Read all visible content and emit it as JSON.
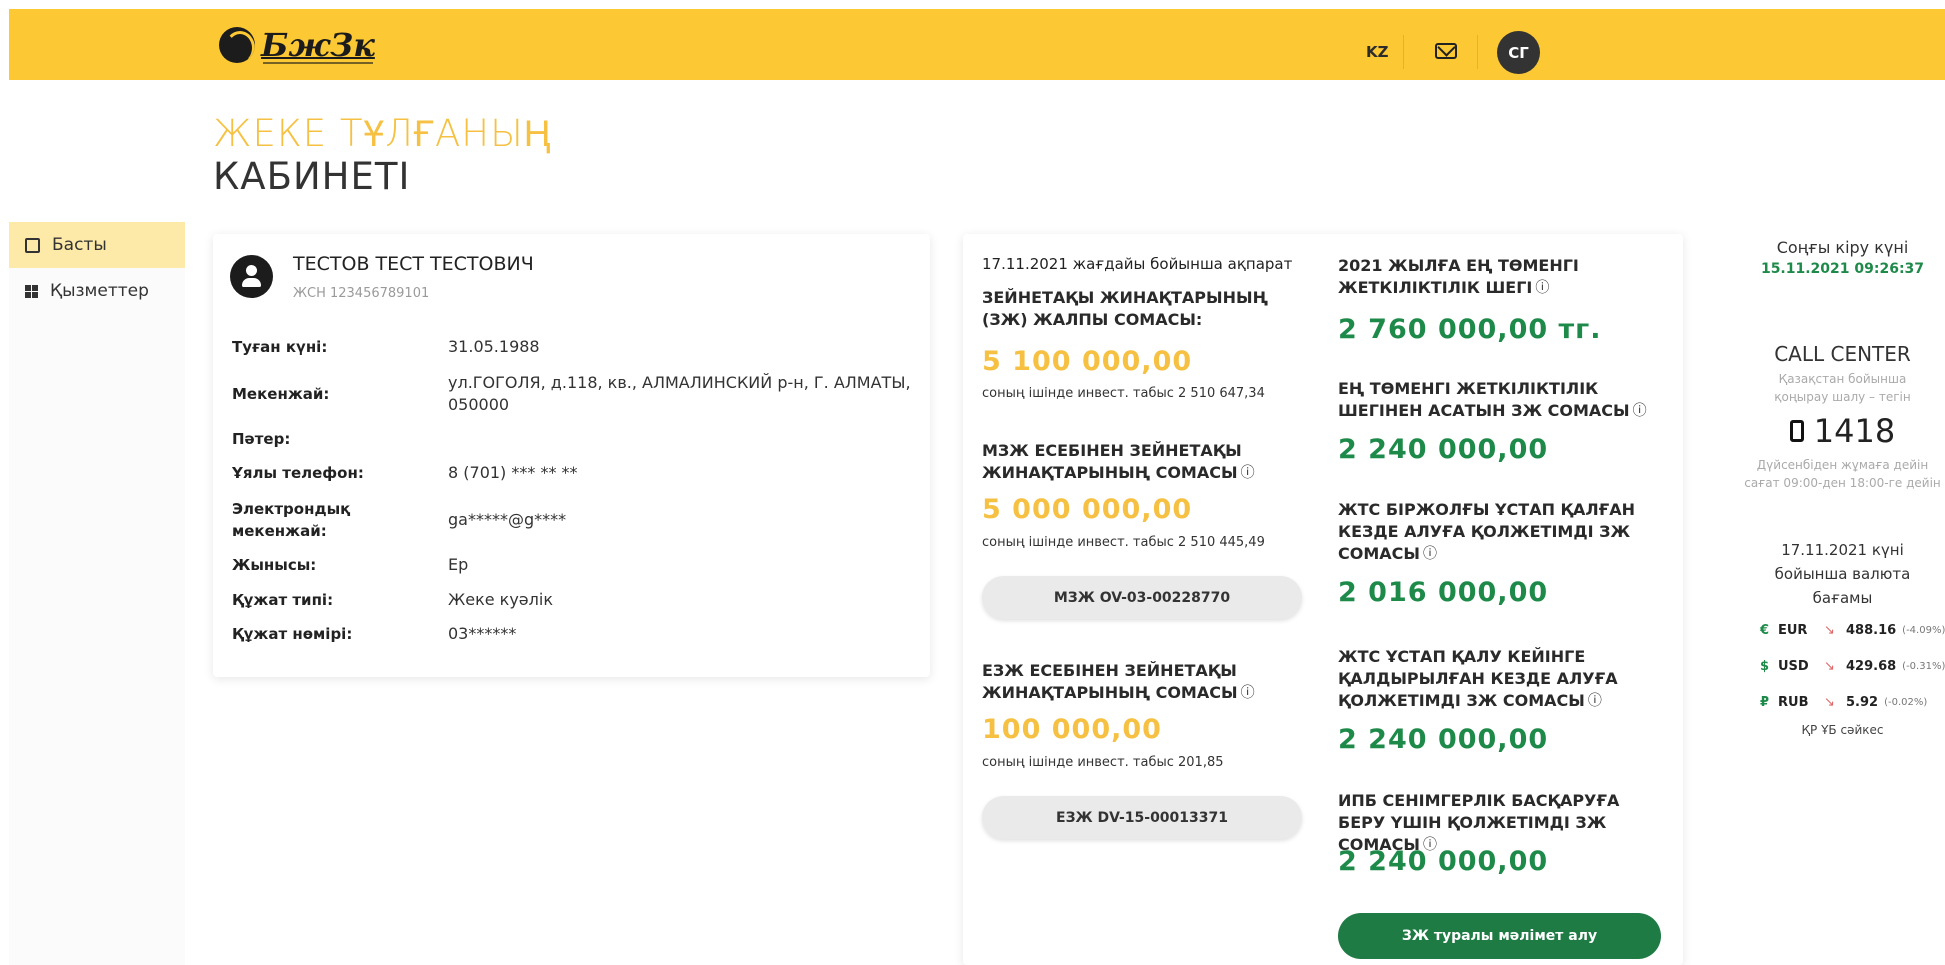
{
  "header": {
    "logo_text": "БжЗк",
    "lang": "KZ",
    "user_initials": "СГ",
    "colors": {
      "bar": "#fcc833",
      "accent_yellow": "#f6c142",
      "accent_green": "#1e8a4a"
    }
  },
  "page": {
    "title_line1": "ЖЕКЕ ТҰЛҒАНЫҢ",
    "title_line2": "КАБИНЕТІ"
  },
  "sidebar": {
    "items": [
      {
        "label": "Басты",
        "icon": "home-icon",
        "active": true
      },
      {
        "label": "Қызметтер",
        "icon": "grid-icon",
        "active": false
      }
    ]
  },
  "profile": {
    "name": "ТЕСТОВ ТЕСТ ТЕСТОВИЧ",
    "iin": "ЖСН 123456789101",
    "fields": [
      {
        "label": "Туған күні:",
        "value": "31.05.1988"
      },
      {
        "label": "Мекенжай:",
        "value": "ул.ГОГОЛЯ, д.118, кв., АЛМАЛИНСКИЙ р-н, Г. АЛМАТЫ, 050000"
      },
      {
        "label": "Пәтер:",
        "value": ""
      },
      {
        "label": "Ұялы телефон:",
        "value": "8 (701) *** ** **"
      },
      {
        "label": "Электрондық мекенжай:",
        "value": "ga*****@g****"
      },
      {
        "label": "Жынысы:",
        "value": "Ер"
      },
      {
        "label": "Құжат типі:",
        "value": "Жеке куәлік"
      },
      {
        "label": "Құжат нөмірі:",
        "value": "03******"
      }
    ]
  },
  "pension": {
    "info_date": "17.11.2021 жағдайы бойынша ақпарат",
    "total_label": "ЗЕЙНЕТАҚЫ ЖИНАҚТАРЫНЫҢ (ЗЖ) ЖАЛПЫ СОМАСЫ:",
    "total_amount": "5 100 000,00",
    "total_sub": "соның ішінде инвест. табыс 2 510 647,34",
    "mzj_label": "МЗЖ ЕСЕБІНЕН ЗЕЙНЕТАҚЫ ЖИНАҚТАРЫНЫҢ СОМАСЫ",
    "mzj_amount": "5 000 000,00",
    "mzj_sub": "соның ішінде инвест. табыс 2 510 445,49",
    "mzj_button": "МЗЖ OV-03-00228770",
    "ezj_label": "ЕЗЖ ЕСЕБІНЕН ЗЕЙНЕТАҚЫ ЖИНАҚТАРЫНЫҢ СОМАСЫ",
    "ezj_amount": "100 000,00",
    "ezj_sub": "соның ішінде инвест. табыс 201,85",
    "ezj_button": "ЕЗЖ DV-15-00013371",
    "min_label": "2021 ЖЫЛҒА ЕҢ ТӨМЕНГІ ЖЕТКІЛІКТІЛІК ШЕГІ",
    "min_amount": "2 760 000,00 тг.",
    "over_label": "ЕҢ ТӨМЕНГІ ЖЕТКІЛІКТІЛІК ШЕГІНЕН АСАТЫН ЗЖ СОМАСЫ",
    "over_amount": "2 240 000,00",
    "zhts_label": "ЖТС БІРЖОЛҒЫ ҰСТАП ҚАЛҒАН КЕЗДЕ АЛУҒА ҚОЛЖЕТІМДІ ЗЖ СОМАСЫ",
    "zhts_amount": "2 016 000,00",
    "zhts2_label": "ЖТС ҰСТАП ҚАЛУ КЕЙІНГЕ ҚАЛДЫРЫЛҒАН КЕЗДЕ АЛУҒА ҚОЛЖЕТІМДІ ЗЖ СОМАСЫ",
    "zhts2_amount": "2 240 000,00",
    "ipb_label": "ИПБ СЕНІМГЕРЛІК БАСҚАРУҒА БЕРУ ҮШІН ҚОЛЖЕТІМДІ ЗЖ СОМАСЫ",
    "ipb_amount": "2 240 000,00",
    "info_button": "ЗЖ туралы мәлімет алу",
    "info_symbol": "ⓘ"
  },
  "right": {
    "last_login_label": "Соңғы кіру күні",
    "last_login_value": "15.11.2021 09:26:37",
    "cc_title": "CALL CENTER",
    "cc_desc1": "Қазақстан бойынша",
    "cc_desc2": "қоңырау шалу – тегін",
    "cc_phone": "1418",
    "cc_hours1": "Дүйсенбіден жұмаға дейін",
    "cc_hours2": "сағат 09:00-ден 18:00-ге дейін",
    "rates_title1": "17.11.2021 күні",
    "rates_title2": "бойынша валюта",
    "rates_title3": "бағамы",
    "rates": [
      {
        "symbol": "€",
        "code": "EUR",
        "value": "488.16",
        "change": "(-4.09%)"
      },
      {
        "symbol": "$",
        "code": "USD",
        "value": "429.68",
        "change": "(-0.31%)"
      },
      {
        "symbol": "₽",
        "code": "RUB",
        "value": "5.92",
        "change": "(-0.02%)"
      }
    ],
    "rates_source": "ҚР ҰБ сәйкес"
  }
}
